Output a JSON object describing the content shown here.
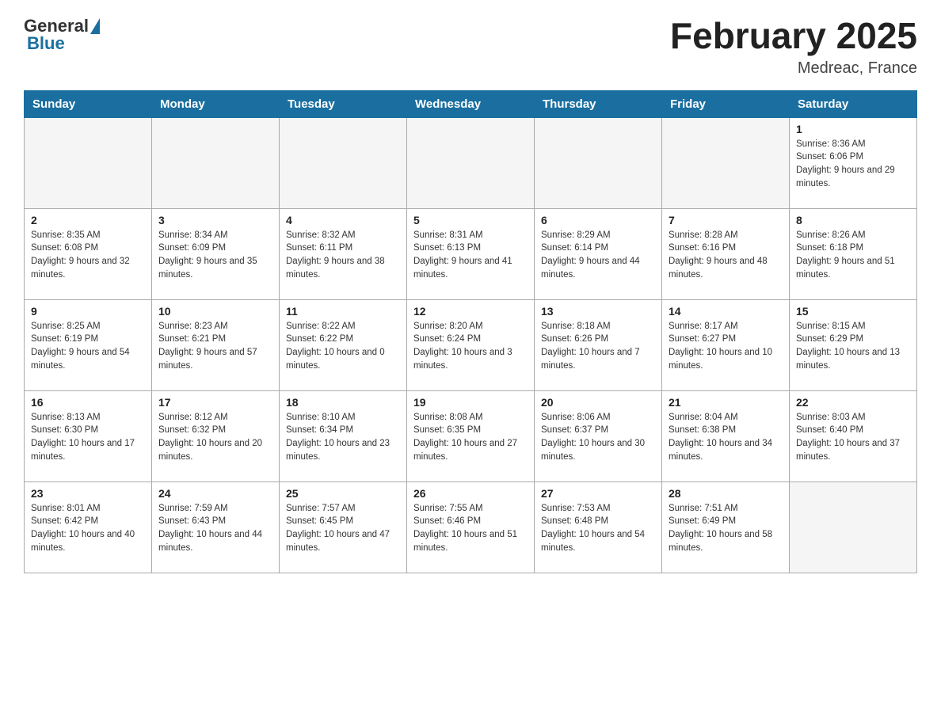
{
  "header": {
    "title": "February 2025",
    "location": "Medreac, France",
    "logo_general": "General",
    "logo_blue": "Blue"
  },
  "days_of_week": [
    "Sunday",
    "Monday",
    "Tuesday",
    "Wednesday",
    "Thursday",
    "Friday",
    "Saturday"
  ],
  "weeks": [
    [
      {
        "day": "",
        "info": ""
      },
      {
        "day": "",
        "info": ""
      },
      {
        "day": "",
        "info": ""
      },
      {
        "day": "",
        "info": ""
      },
      {
        "day": "",
        "info": ""
      },
      {
        "day": "",
        "info": ""
      },
      {
        "day": "1",
        "info": "Sunrise: 8:36 AM\nSunset: 6:06 PM\nDaylight: 9 hours and 29 minutes."
      }
    ],
    [
      {
        "day": "2",
        "info": "Sunrise: 8:35 AM\nSunset: 6:08 PM\nDaylight: 9 hours and 32 minutes."
      },
      {
        "day": "3",
        "info": "Sunrise: 8:34 AM\nSunset: 6:09 PM\nDaylight: 9 hours and 35 minutes."
      },
      {
        "day": "4",
        "info": "Sunrise: 8:32 AM\nSunset: 6:11 PM\nDaylight: 9 hours and 38 minutes."
      },
      {
        "day": "5",
        "info": "Sunrise: 8:31 AM\nSunset: 6:13 PM\nDaylight: 9 hours and 41 minutes."
      },
      {
        "day": "6",
        "info": "Sunrise: 8:29 AM\nSunset: 6:14 PM\nDaylight: 9 hours and 44 minutes."
      },
      {
        "day": "7",
        "info": "Sunrise: 8:28 AM\nSunset: 6:16 PM\nDaylight: 9 hours and 48 minutes."
      },
      {
        "day": "8",
        "info": "Sunrise: 8:26 AM\nSunset: 6:18 PM\nDaylight: 9 hours and 51 minutes."
      }
    ],
    [
      {
        "day": "9",
        "info": "Sunrise: 8:25 AM\nSunset: 6:19 PM\nDaylight: 9 hours and 54 minutes."
      },
      {
        "day": "10",
        "info": "Sunrise: 8:23 AM\nSunset: 6:21 PM\nDaylight: 9 hours and 57 minutes."
      },
      {
        "day": "11",
        "info": "Sunrise: 8:22 AM\nSunset: 6:22 PM\nDaylight: 10 hours and 0 minutes."
      },
      {
        "day": "12",
        "info": "Sunrise: 8:20 AM\nSunset: 6:24 PM\nDaylight: 10 hours and 3 minutes."
      },
      {
        "day": "13",
        "info": "Sunrise: 8:18 AM\nSunset: 6:26 PM\nDaylight: 10 hours and 7 minutes."
      },
      {
        "day": "14",
        "info": "Sunrise: 8:17 AM\nSunset: 6:27 PM\nDaylight: 10 hours and 10 minutes."
      },
      {
        "day": "15",
        "info": "Sunrise: 8:15 AM\nSunset: 6:29 PM\nDaylight: 10 hours and 13 minutes."
      }
    ],
    [
      {
        "day": "16",
        "info": "Sunrise: 8:13 AM\nSunset: 6:30 PM\nDaylight: 10 hours and 17 minutes."
      },
      {
        "day": "17",
        "info": "Sunrise: 8:12 AM\nSunset: 6:32 PM\nDaylight: 10 hours and 20 minutes."
      },
      {
        "day": "18",
        "info": "Sunrise: 8:10 AM\nSunset: 6:34 PM\nDaylight: 10 hours and 23 minutes."
      },
      {
        "day": "19",
        "info": "Sunrise: 8:08 AM\nSunset: 6:35 PM\nDaylight: 10 hours and 27 minutes."
      },
      {
        "day": "20",
        "info": "Sunrise: 8:06 AM\nSunset: 6:37 PM\nDaylight: 10 hours and 30 minutes."
      },
      {
        "day": "21",
        "info": "Sunrise: 8:04 AM\nSunset: 6:38 PM\nDaylight: 10 hours and 34 minutes."
      },
      {
        "day": "22",
        "info": "Sunrise: 8:03 AM\nSunset: 6:40 PM\nDaylight: 10 hours and 37 minutes."
      }
    ],
    [
      {
        "day": "23",
        "info": "Sunrise: 8:01 AM\nSunset: 6:42 PM\nDaylight: 10 hours and 40 minutes."
      },
      {
        "day": "24",
        "info": "Sunrise: 7:59 AM\nSunset: 6:43 PM\nDaylight: 10 hours and 44 minutes."
      },
      {
        "day": "25",
        "info": "Sunrise: 7:57 AM\nSunset: 6:45 PM\nDaylight: 10 hours and 47 minutes."
      },
      {
        "day": "26",
        "info": "Sunrise: 7:55 AM\nSunset: 6:46 PM\nDaylight: 10 hours and 51 minutes."
      },
      {
        "day": "27",
        "info": "Sunrise: 7:53 AM\nSunset: 6:48 PM\nDaylight: 10 hours and 54 minutes."
      },
      {
        "day": "28",
        "info": "Sunrise: 7:51 AM\nSunset: 6:49 PM\nDaylight: 10 hours and 58 minutes."
      },
      {
        "day": "",
        "info": ""
      }
    ]
  ]
}
